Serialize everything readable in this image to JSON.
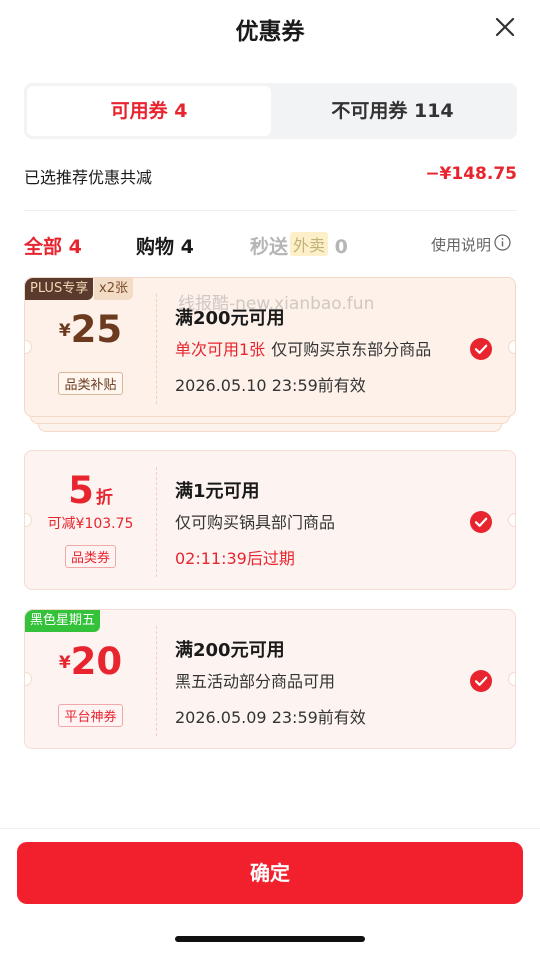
{
  "header": {
    "title": "优惠券",
    "close_icon": "close-icon"
  },
  "tabs": {
    "available": "可用券 4",
    "unavailable": "不可用券 114"
  },
  "summary": {
    "label": "已选推荐优惠共减",
    "amount": "−¥148.75"
  },
  "filters": {
    "all": "全部 4",
    "shopping": "购物 4",
    "flash_prefix": "秒送",
    "flash_tag": "外卖",
    "flash_count": "0",
    "help": "使用说明"
  },
  "watermark": "线报酷-new.xianbao.fun",
  "coupons": [
    {
      "corner": "PLUS专享",
      "multiplier": "x2张",
      "currency": "¥",
      "value": "25",
      "badge": "品类补贴",
      "condition": "满200元可用",
      "limit_text": "单次可用1张",
      "scope": "仅可购买京东部分商品",
      "validity": "2026.05.10 23:59前有效"
    },
    {
      "value": "5",
      "value_unit": "折",
      "sub": "可减¥103.75",
      "badge": "品类券",
      "condition": "满1元可用",
      "scope": "仅可购买锅具部门商品",
      "expiry": "02:11:39后过期"
    },
    {
      "corner": "黑色星期五",
      "currency": "¥",
      "value": "20",
      "badge": "平台神券",
      "condition": "满200元可用",
      "scope": "黑五活动部分商品可用",
      "validity": "2026.05.09 23:59前有效"
    }
  ],
  "confirm_label": "确定",
  "colors": {
    "accent": "#e8252f",
    "button": "#f2202c",
    "plus_tag": "#5a3a2c",
    "black_friday_tag": "#33c23a"
  }
}
